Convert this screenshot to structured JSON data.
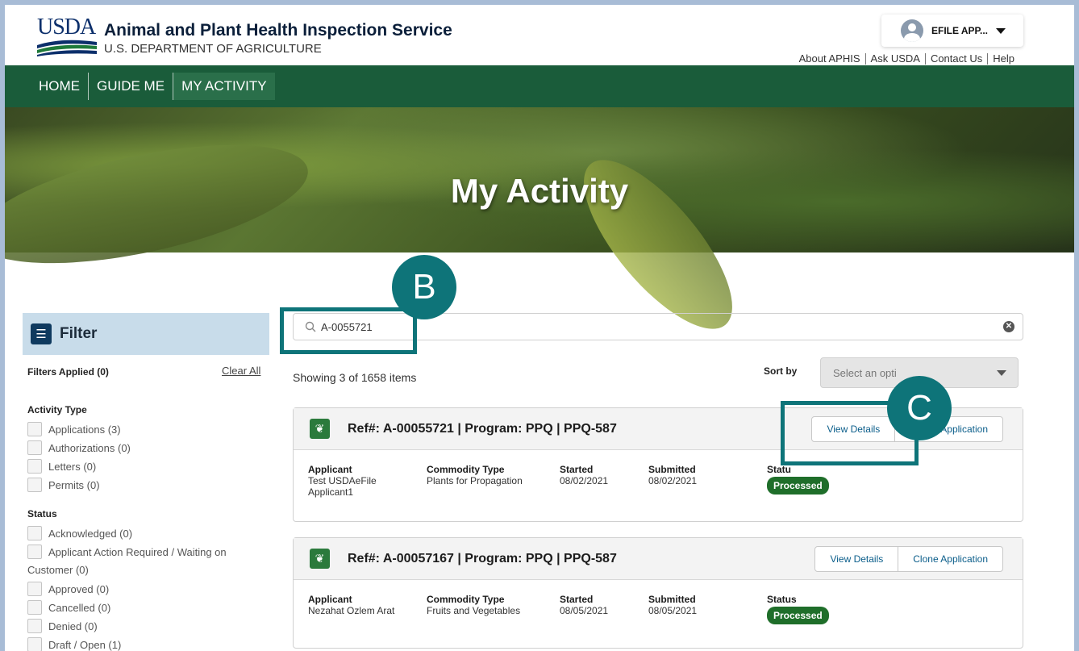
{
  "header": {
    "logo_text": "USDA",
    "agency": "Animal and Plant Health Inspection Service",
    "department": "U.S. DEPARTMENT OF AGRICULTURE",
    "user_name": "EFILE APP...",
    "util_links": [
      "About APHIS",
      "Ask USDA",
      "Contact Us",
      "Help"
    ]
  },
  "nav": {
    "items": [
      "HOME",
      "GUIDE ME",
      "MY ACTIVITY"
    ]
  },
  "hero": {
    "title": "My Activity"
  },
  "filter": {
    "title": "Filter",
    "applied": "Filters Applied (0)",
    "clear_all": "Clear All",
    "activity_type": {
      "title": "Activity Type",
      "items": [
        "Applications (3)",
        "Authorizations (0)",
        "Letters (0)",
        "Permits (0)"
      ]
    },
    "status": {
      "title": "Status",
      "items": [
        "Acknowledged (0)",
        "Applicant Action Required / Waiting on",
        "Customer (0)",
        "Approved (0)",
        "Cancelled (0)",
        "Denied (0)",
        "Draft / Open (1)"
      ]
    }
  },
  "search": {
    "value": "A-0055721"
  },
  "results": {
    "showing": "Showing 3 of 1658 items"
  },
  "sort": {
    "label": "Sort by",
    "placeholder": "Select an opti"
  },
  "cards": [
    {
      "title": "Ref#: A-00055721 | Program: PPQ | PPQ-587",
      "view_details": "View Details",
      "clone": "Application",
      "applicant_label": "Applicant",
      "applicant": "Test USDAeFile",
      "applicant2": "Applicant1",
      "commodity_label": "Commodity Type",
      "commodity": "Plants for Propagation",
      "started_label": "Started",
      "started": "08/02/2021",
      "submitted_label": "Submitted",
      "submitted": "08/02/2021",
      "status_label": "Statu",
      "status": "Processed"
    },
    {
      "title": "Ref#: A-00057167 | Program: PPQ | PPQ-587",
      "view_details": "View Details",
      "clone": "Clone Application",
      "applicant_label": "Applicant",
      "applicant": "Nezahat Ozlem Arat",
      "commodity_label": "Commodity Type",
      "commodity": "Fruits and Vegetables",
      "started_label": "Started",
      "started": "08/05/2021",
      "submitted_label": "Submitted",
      "submitted": "08/05/2021",
      "status_label": "Status",
      "status": "Processed"
    }
  ],
  "annotations": {
    "b": "B",
    "c": "C"
  },
  "colors": {
    "nav": "#1a5c3a",
    "annotation": "#0e7479",
    "badge": "#1f6e2a"
  }
}
